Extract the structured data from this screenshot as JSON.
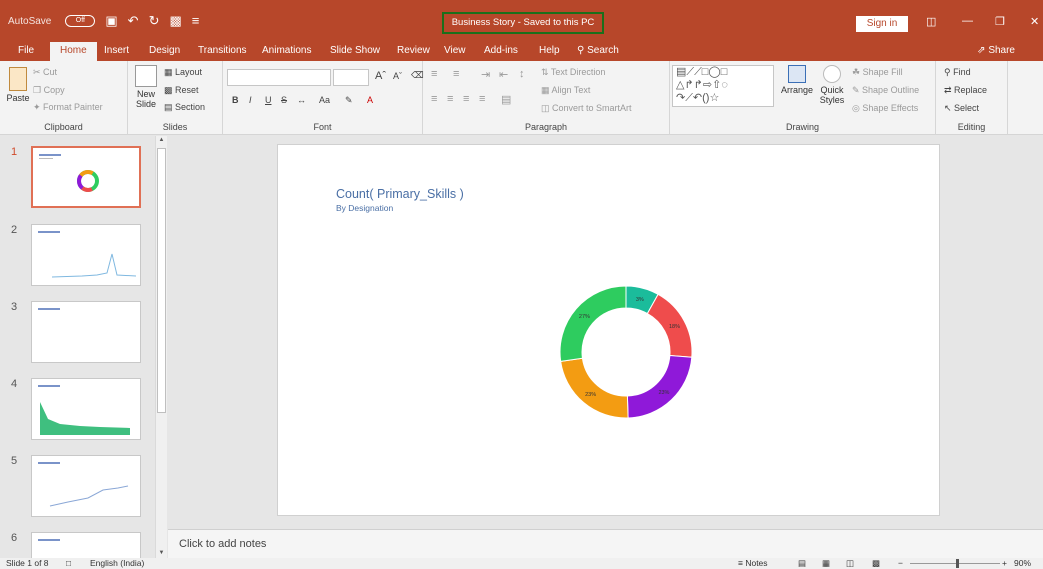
{
  "titlebar": {
    "autosave_label": "AutoSave",
    "autosave_state": "Off",
    "doc_title": "Business Story - Saved to this PC",
    "signin": "Sign in"
  },
  "tabs": [
    "File",
    "Home",
    "Insert",
    "Design",
    "Transitions",
    "Animations",
    "Slide Show",
    "Review",
    "View",
    "Add-ins",
    "Help"
  ],
  "tell_me": "Search",
  "share": "Share",
  "ribbon": {
    "clipboard": {
      "paste": "Paste",
      "cut": "Cut",
      "copy": "Copy",
      "format_painter": "Format Painter",
      "label": "Clipboard"
    },
    "slides": {
      "new_slide": "New Slide",
      "layout": "Layout",
      "reset": "Reset",
      "section": "Section",
      "label": "Slides"
    },
    "font": {
      "label": "Font",
      "bold": "B",
      "italic": "I",
      "underline": "U",
      "strike": "S",
      "case": "Aa"
    },
    "paragraph": {
      "text_direction": "Text Direction",
      "align_text": "Align Text",
      "smartart": "Convert to SmartArt",
      "label": "Paragraph"
    },
    "drawing": {
      "arrange": "Arrange",
      "quick_styles": "Quick Styles",
      "shape_fill": "Shape Fill",
      "shape_outline": "Shape Outline",
      "shape_effects": "Shape Effects",
      "label": "Drawing"
    },
    "editing": {
      "find": "Find",
      "replace": "Replace",
      "select": "Select",
      "label": "Editing"
    }
  },
  "thumbnails": [
    "1",
    "2",
    "3",
    "4",
    "5",
    "6"
  ],
  "slide": {
    "title": "Count( Primary_Skills )",
    "subtitle": "By Designation"
  },
  "chart_data": {
    "type": "donut",
    "series": [
      {
        "values": [
          8,
          18,
          23,
          23,
          27
        ],
        "colors": [
          "#1bbc9b",
          "#ef4c4c",
          "#8f19d9",
          "#f39c12",
          "#2ecc5f"
        ]
      }
    ],
    "labels": [
      "3%",
      "18%",
      "23%",
      "23%",
      "27%"
    ],
    "label_values": [
      "3%",
      "18%",
      "",
      "23%",
      "27%"
    ]
  },
  "notes_placeholder": "Click to add notes",
  "status": {
    "slide_count": "Slide 1 of 8",
    "language": "English (India)",
    "notes": "Notes",
    "zoom": "90%"
  }
}
